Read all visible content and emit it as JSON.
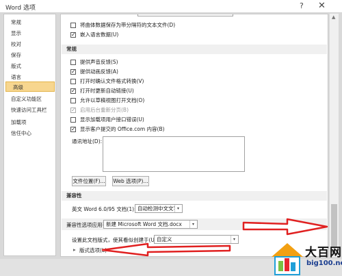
{
  "window": {
    "title": "Word 选项",
    "help_glyph": "?",
    "close_glyph": "✕"
  },
  "sidebar": {
    "items": [
      {
        "label": "常规"
      },
      {
        "label": "显示"
      },
      {
        "label": "校对"
      },
      {
        "label": "保存"
      },
      {
        "label": "版式"
      },
      {
        "label": "语言"
      },
      {
        "label": "高级",
        "active": true
      },
      {
        "label": "自定义功能区"
      },
      {
        "label": "快速访问工具栏"
      },
      {
        "label": "加载项"
      },
      {
        "label": "信任中心"
      }
    ]
  },
  "top_options": [
    {
      "label": "将曲体数据保存为带分隔符的文本文件(D)",
      "checked": false
    },
    {
      "label": "嵌入语言数据(U)",
      "checked": true
    }
  ],
  "general": {
    "heading": "常规",
    "options": [
      {
        "label": "提供声音反馈(S)",
        "checked": false
      },
      {
        "label": "提供动画反馈(A)",
        "checked": true
      },
      {
        "label": "打开时确认文件格式转换(V)",
        "checked": false
      },
      {
        "label": "打开时更新自动链接(U)",
        "checked": true
      },
      {
        "label": "允许以草稿视图打开文档(O)",
        "checked": false
      },
      {
        "label": "启用后台重新分页(B)",
        "checked": true,
        "disabled": true
      },
      {
        "label": "显示加载项用户接口错误(U)",
        "checked": false
      },
      {
        "label": "显示客户提交的 Office.com 内容(B)",
        "checked": true
      }
    ],
    "mailing_address_label": "通讯地址(D):",
    "file_locations_button": "文件位置(F)...",
    "web_options_button": "Web 选项(P)..."
  },
  "compatibility": {
    "heading": "兼容性",
    "word6_label": "英文 Word 6.0/95 文档(1):",
    "word6_value": "自动检测中文文字",
    "compat_options_label": "兼容性选项应用于(C):",
    "compat_doc_value": "新建 Microsoft Word 文档.docx",
    "layout_as_label": "设置此文档版式，使其看似创建于(U):",
    "layout_as_value": "自定义",
    "layout_options_label": "版式选项(L)",
    "expand_glyph": "▸"
  },
  "dropdown_glyph": "▾",
  "scroll_up_glyph": "▲",
  "scroll_down_glyph": "▼",
  "watermark": {
    "brand": "大百网",
    "domain": "big100.net"
  },
  "colors": {
    "active_item": "#f7d68f",
    "annotation_arrow": "#e02020"
  }
}
